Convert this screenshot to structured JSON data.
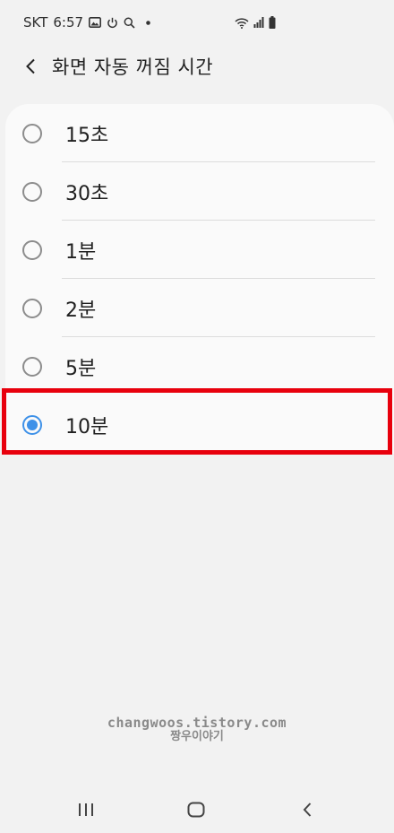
{
  "status_bar": {
    "carrier": "SKT",
    "time": "6:57",
    "left_icons": [
      "image-icon",
      "power-icon",
      "search-icon",
      "dot-icon"
    ],
    "right_icons": [
      "wifi-icon",
      "signal-icon",
      "battery-icon"
    ]
  },
  "header": {
    "back_icon": "chevron-left-icon",
    "title": "화면 자동 꺼짐 시간"
  },
  "options": [
    {
      "label": "15초",
      "selected": false
    },
    {
      "label": "30초",
      "selected": false
    },
    {
      "label": "1분",
      "selected": false
    },
    {
      "label": "2분",
      "selected": false
    },
    {
      "label": "5분",
      "selected": false
    },
    {
      "label": "10분",
      "selected": true
    }
  ],
  "colors": {
    "accent": "#3e91e8",
    "highlight_box": "#e8000d",
    "background": "#f2f2f2",
    "card": "#fafafa"
  },
  "watermark": {
    "url": "changwoos.tistory.com",
    "name": "짱우이야기"
  },
  "nav_bar": {
    "icons": [
      "recent-apps-icon",
      "home-icon",
      "back-icon"
    ]
  }
}
